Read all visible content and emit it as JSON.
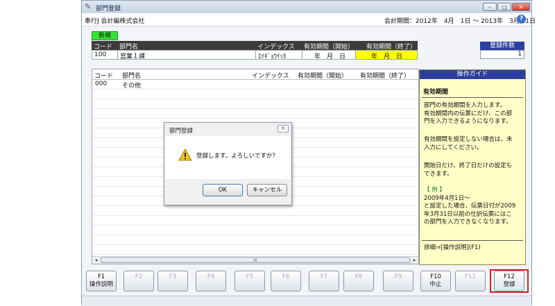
{
  "window": {
    "title": "部門登録",
    "controls": {
      "minimize": "–",
      "maximize": "□",
      "close": "✕"
    }
  },
  "menubar": {
    "company": "奉行J 会計編株式会社",
    "period": "会計期間：2012年　4月　1日 ～ 2013年　3月 31日",
    "help_icon": "?"
  },
  "entry": {
    "new_label": "新規",
    "headers": [
      "コード",
      "部門名",
      "インデックス",
      "有効期間（開始）",
      "有効期間（終了）"
    ],
    "row": {
      "code": "100",
      "name": "営業１課",
      "index": "ｴｲｷﾞｮｳｲｯｶ",
      "start": "年　月　日",
      "end": "年　月　日"
    }
  },
  "count": {
    "label": "登録件数",
    "value": "1"
  },
  "list": {
    "headers": [
      "コード",
      "部門名",
      "インデックス",
      "有効期間（開始）",
      "有効期間（終了）"
    ],
    "rows": [
      {
        "code": "000",
        "name": "その他"
      }
    ],
    "scroll_left": "◂",
    "scroll_right": "▸",
    "scroll_grip": "III"
  },
  "guide": {
    "header": "操作ガイド",
    "title": "有効期間",
    "para1": [
      "部門の有効期間を入力します。",
      "有効期間内の伝票にだけ、この部",
      "門を入力できるようになります。"
    ],
    "para2": [
      "有効期間を設定しない場合は、未",
      "入力にしてください。"
    ],
    "para3": [
      "開始日だけ、終了日だけの設定も",
      "できます。"
    ],
    "example_label": "【 例 】",
    "example": [
      "2009年4月1日～",
      "と設定した場合、伝票日付が2009",
      "年3月31日以前の仕訳伝票にはこ",
      "の部門を入力できなくなります。"
    ],
    "footer": "詳細⇒[操作説明](F1)"
  },
  "fkeys": [
    {
      "key": "F1",
      "label": "操作説明",
      "enabled": true
    },
    {
      "key": "F2",
      "label": "",
      "enabled": false
    },
    {
      "key": "F3",
      "label": "",
      "enabled": false
    },
    {
      "key": "F4",
      "label": "",
      "enabled": false
    },
    {
      "key": "F5",
      "label": "",
      "enabled": false
    },
    {
      "key": "F6",
      "label": "",
      "enabled": false
    },
    {
      "key": "F7",
      "label": "",
      "enabled": false
    },
    {
      "key": "F8",
      "label": "",
      "enabled": false
    },
    {
      "key": "F9",
      "label": "",
      "enabled": false
    },
    {
      "key": "F10",
      "label": "中止",
      "enabled": true
    },
    {
      "key": "F11",
      "label": "",
      "enabled": false
    },
    {
      "key": "F12",
      "label": "登録",
      "enabled": true
    }
  ],
  "dialog": {
    "title": "部門登録",
    "close": "✕",
    "message": "登録します。よろしいですか？",
    "ok": "OK",
    "cancel": "キャンセル"
  },
  "colors": {
    "new_badge": "#39e335",
    "header_dark": "#3c3c3c",
    "end_date_highlight": "#ffff00",
    "guide_bg": "#ffffc8",
    "blue_header": "#2c3fa0",
    "f12_highlight": "#d82020"
  }
}
